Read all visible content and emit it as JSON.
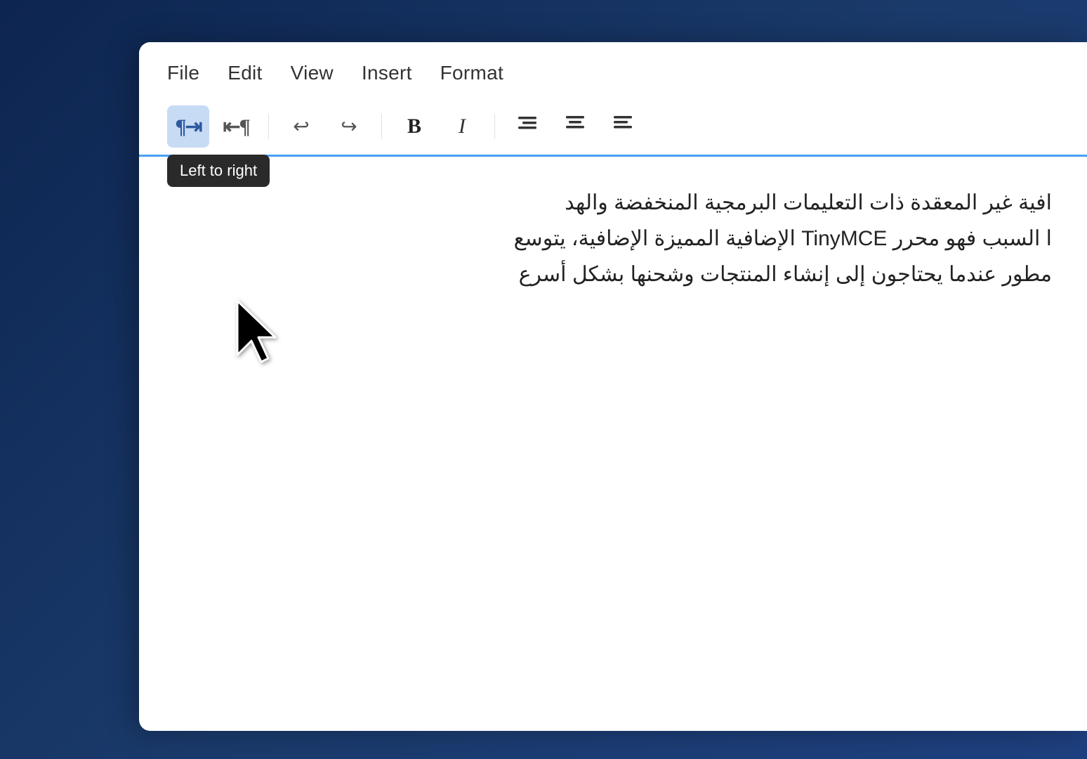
{
  "background": {
    "color": "#1a3a6b"
  },
  "editor": {
    "menu": {
      "items": [
        {
          "id": "file",
          "label": "File"
        },
        {
          "id": "edit",
          "label": "Edit"
        },
        {
          "id": "view",
          "label": "View"
        },
        {
          "id": "insert",
          "label": "Insert"
        },
        {
          "id": "format",
          "label": "Format"
        }
      ]
    },
    "toolbar": {
      "buttons": [
        {
          "id": "ltr",
          "icon": "¶→",
          "label": "Left to right",
          "active": true,
          "tooltip": "Left to right"
        },
        {
          "id": "rtl",
          "icon": "←¶",
          "label": "Right to left",
          "active": false,
          "tooltip": "Right to left"
        },
        {
          "id": "undo",
          "icon": "↩",
          "label": "Undo",
          "active": false
        },
        {
          "id": "redo",
          "icon": "↪",
          "label": "Redo",
          "active": false
        },
        {
          "id": "bold",
          "icon": "B",
          "label": "Bold",
          "active": false
        },
        {
          "id": "italic",
          "icon": "I",
          "label": "Italic",
          "active": false
        },
        {
          "id": "align-right",
          "icon": "≡",
          "label": "Align right",
          "active": false
        },
        {
          "id": "align-center",
          "icon": "≡",
          "label": "Align center",
          "active": false
        },
        {
          "id": "align-left",
          "icon": "≡",
          "label": "Align left",
          "active": false
        }
      ],
      "tooltip_visible": "Left to right"
    },
    "content": {
      "lines": [
        "افية غير المعقدة ذات التعليمات البرمجية المنخفضة والهد",
        "ا السبب فهو محرر TinyMCE الإضافية المميزة الإضافية، يتوسع",
        "مطور عندما يحتاجون إلى إنشاء المنتجات وشحنها بشكل أسرع"
      ]
    }
  }
}
